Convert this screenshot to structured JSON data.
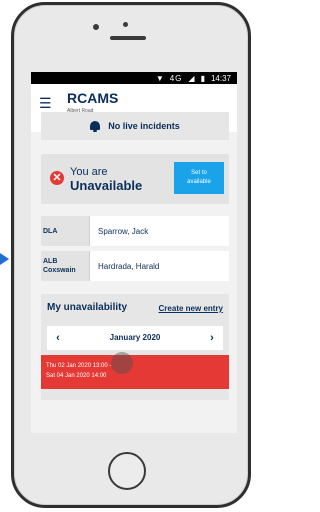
{
  "status_bar": {
    "network": "4G",
    "time": "14:37"
  },
  "header": {
    "title": "RCAMS",
    "subtitle": "Albert Road"
  },
  "incidents": {
    "text": "No live incidents"
  },
  "availability": {
    "line1": "You are",
    "line2": "Unavailable",
    "button_line1": "Set to",
    "button_line2": "available"
  },
  "roles": [
    {
      "label": "DLA",
      "value": "Sparrow, Jack"
    },
    {
      "label_line1": "ALB",
      "label_line2": "Coxswain",
      "value": "Hardrada, Harald"
    }
  ],
  "my_unavailability": {
    "title": "My unavailability",
    "create_link": "Create new entry",
    "month": "January 2020",
    "entries": [
      {
        "line1": "Thu 02 Jan 2020 13:00 -",
        "line2": "Sat 04 Jan 2020 14:00"
      }
    ]
  },
  "colors": {
    "navy": "#0b2f5a",
    "accent": "#1aa3e8",
    "danger": "#e53935"
  }
}
